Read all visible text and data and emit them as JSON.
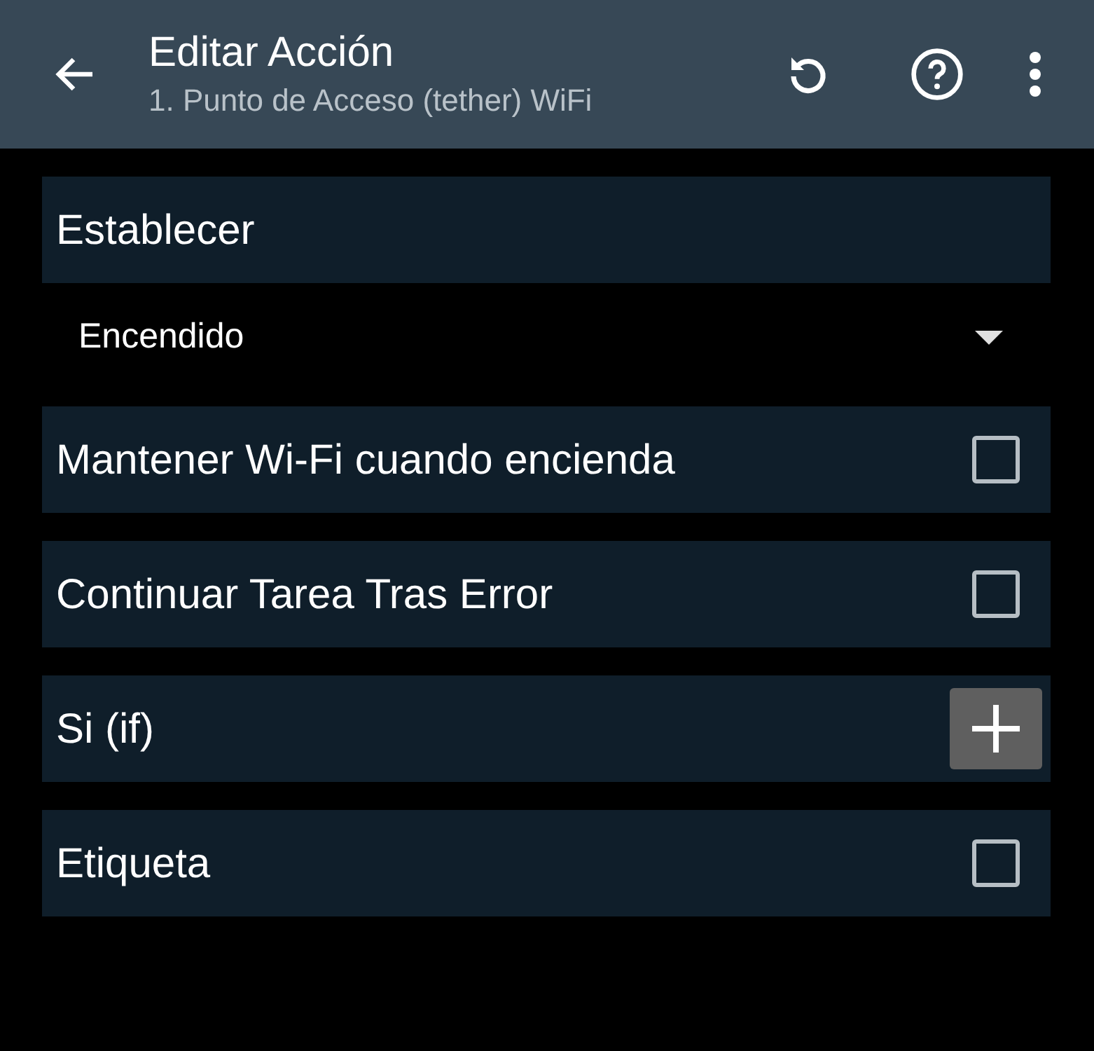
{
  "app_bar": {
    "title": "Editar Acción",
    "subtitle": "1. Punto de Acceso (tether) WiFi"
  },
  "rows": [
    {
      "kind": "section",
      "label": "Establecer"
    },
    {
      "kind": "dropdown",
      "value": "Encendido"
    },
    {
      "kind": "checkbox",
      "label": "Mantener Wi-Fi cuando encienda",
      "checked": false
    },
    {
      "kind": "checkbox",
      "label": "Continuar Tarea Tras Error",
      "checked": false
    },
    {
      "kind": "add",
      "label": "Si (if)"
    },
    {
      "kind": "checkbox",
      "label": "Etiqueta",
      "checked": false
    }
  ]
}
